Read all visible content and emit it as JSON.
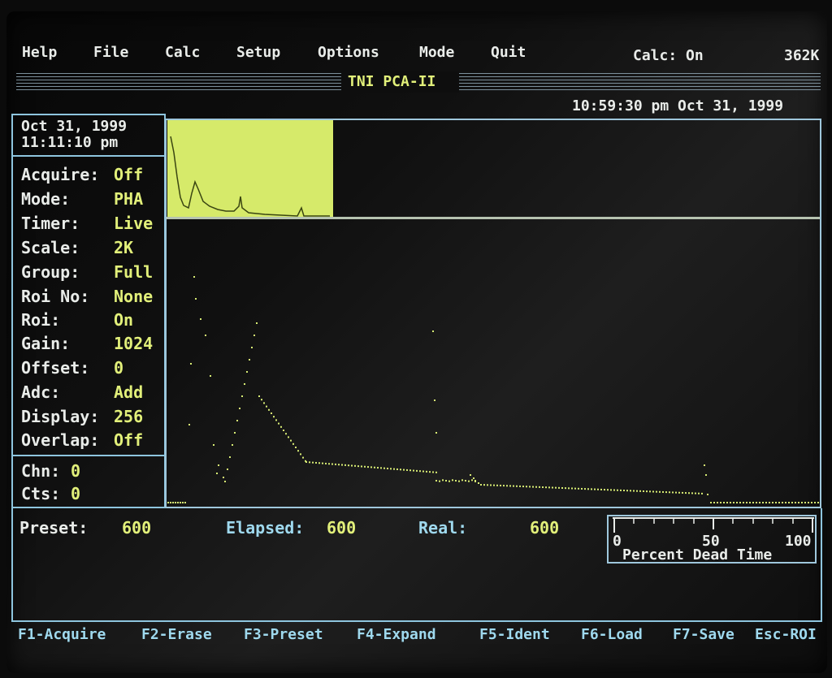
{
  "menu": {
    "items": [
      "Help",
      "File",
      "Calc",
      "Setup",
      "Options",
      "Mode",
      "Quit"
    ],
    "calc_status": "Calc: On",
    "memory": "362K"
  },
  "title": "TNI PCA-II",
  "clock": "10:59:30 pm Oct 31, 1999",
  "panel": {
    "date": "Oct 31, 1999",
    "time": "11:11:10 pm",
    "params": [
      {
        "label": "Acquire:",
        "value": "Off"
      },
      {
        "label": "Mode:",
        "value": "PHA"
      },
      {
        "label": "Timer:",
        "value": "Live"
      },
      {
        "label": "Scale:",
        "value": "2K"
      },
      {
        "label": "Group:",
        "value": "Full"
      },
      {
        "label": "Roi No:",
        "value": "None"
      },
      {
        "label": "Roi:",
        "value": "On"
      },
      {
        "label": "Gain:",
        "value": "1024"
      },
      {
        "label": "Offset:",
        "value": "0"
      },
      {
        "label": "Adc:",
        "value": "Add"
      },
      {
        "label": "Display:",
        "value": "256"
      },
      {
        "label": "Overlap:",
        "value": "Off"
      }
    ],
    "chn_label": "Chn:",
    "chn_value": "0",
    "cts_label": "Cts:",
    "cts_value": "0"
  },
  "timers": {
    "preset_label": "Preset:",
    "preset_value": "600",
    "elapsed_label": "Elapsed:",
    "elapsed_value": "600",
    "real_label": "Real:",
    "real_value": "600"
  },
  "dead_time": {
    "label": "Percent Dead Time",
    "tick_0": "0",
    "tick_50": "50",
    "tick_100": "100",
    "value_percent": 0
  },
  "function_keys": [
    "F1-Acquire",
    "F2-Erase",
    "F3-Preset",
    "F4-Expand",
    "F5-Ident",
    "F6-Load",
    "F7-Save",
    "Esc-ROI"
  ],
  "colors": {
    "label": "#e9ece9",
    "value": "#e2f07a",
    "accent": "#9fd9ee",
    "overview_fill": "#d6ea6a"
  }
}
